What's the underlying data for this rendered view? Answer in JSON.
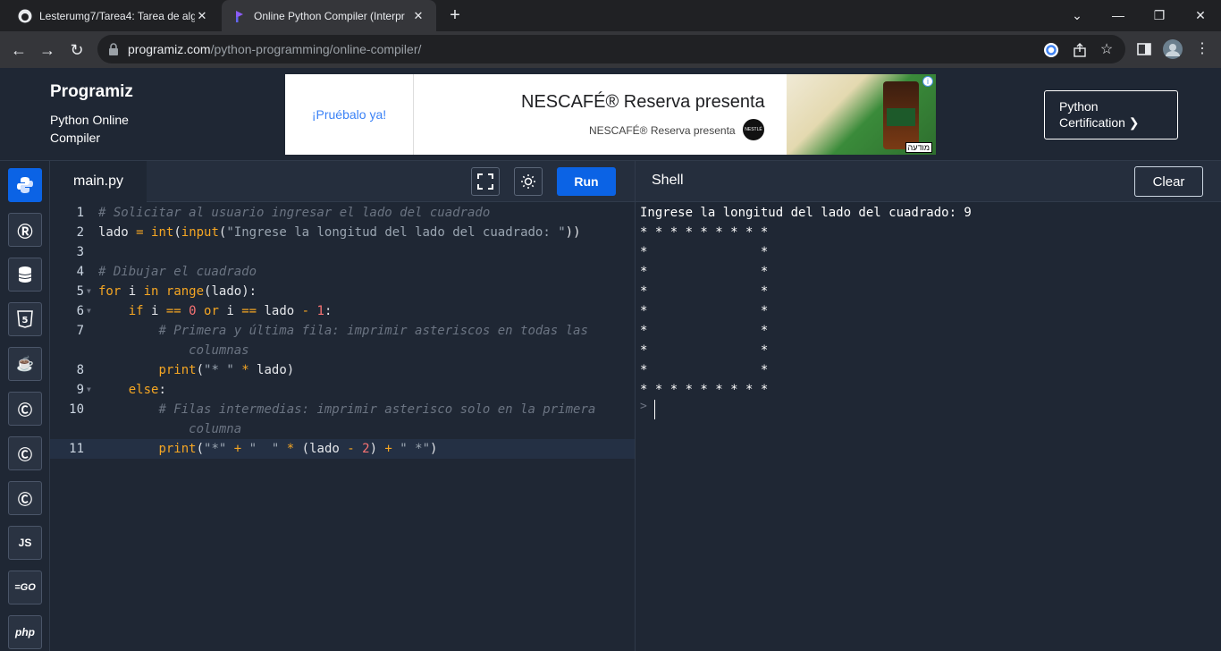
{
  "browser": {
    "tabs": [
      {
        "title": "Lesterumg7/Tarea4: Tarea de alg",
        "icon": "github-icon",
        "active": false
      },
      {
        "title": "Online Python Compiler (Interpr",
        "icon": "programiz-icon",
        "active": true
      }
    ],
    "url_host": "programiz.com",
    "url_path": "/python-programming/online-compiler/"
  },
  "header": {
    "logo": "Programiz",
    "subtitle": "Python Online Compiler",
    "cert_button": "Python Certification ❯"
  },
  "ad": {
    "cta": "¡Pruébalo ya!",
    "title": "NESCAFÉ® Reserva presenta",
    "subtitle": "NESCAFÉ® Reserva presenta",
    "tag": "מודעה"
  },
  "languages": [
    "python",
    "r",
    "sql",
    "html",
    "java",
    "c",
    "cpp",
    "csharp",
    "js",
    "go",
    "php"
  ],
  "editor": {
    "filename": "main.py",
    "run_label": "Run",
    "lines": [
      {
        "n": "1",
        "html": "<span class='cm'># Solicitar al usuario ingresar el lado del cuadrado</span>"
      },
      {
        "n": "2",
        "html": "lado <span class='op'>=</span> <span class='fn'>int</span>(<span class='fn'>input</span>(<span class='st'>\"Ingrese la longitud del lado del cuadrado: \"</span>))"
      },
      {
        "n": "3",
        "html": ""
      },
      {
        "n": "4",
        "html": "<span class='cm'># Dibujar el cuadrado</span>"
      },
      {
        "n": "5",
        "fold": true,
        "html": "<span class='kw'>for</span> i <span class='kw'>in</span> <span class='fn'>range</span>(lado):"
      },
      {
        "n": "6",
        "fold": true,
        "html": "    <span class='kw'>if</span> i <span class='op'>==</span> <span class='nm'>0</span> <span class='kw'>or</span> i <span class='op'>==</span> lado <span class='op'>-</span> <span class='nm'>1</span>:"
      },
      {
        "n": "7",
        "html": "        <span class='cm'># Primera y última fila: imprimir asteriscos en todas las</span>"
      },
      {
        "n": "",
        "html": "            <span class='cm'>columnas</span>"
      },
      {
        "n": "8",
        "html": "        <span class='fn'>print</span>(<span class='st'>\"* \"</span> <span class='op'>*</span> lado)"
      },
      {
        "n": "9",
        "fold": true,
        "html": "    <span class='kw'>else</span>:"
      },
      {
        "n": "10",
        "html": "        <span class='cm'># Filas intermedias: imprimir asterisco solo en la primera</span>"
      },
      {
        "n": "",
        "html": "            <span class='cm'>columna</span>"
      },
      {
        "n": "11",
        "cur": true,
        "html": "        <span class='fn'>print</span>(<span class='st'>\"*\"</span> <span class='op'>+</span> <span class='st'>\"  \"</span> <span class='op'>*</span> (lado <span class='op'>-</span> <span class='nm'>2</span>) <span class='op'>+</span> <span class='st'>\" *\"</span>)"
      }
    ]
  },
  "shell": {
    "title": "Shell",
    "clear_label": "Clear",
    "output": [
      "Ingrese la longitud del lado del cuadrado: 9",
      "* * * * * * * * *",
      "*               *",
      "*               *",
      "*               *",
      "*               *",
      "*               *",
      "*               *",
      "*               *",
      "* * * * * * * * *"
    ],
    "prompt": ">"
  }
}
